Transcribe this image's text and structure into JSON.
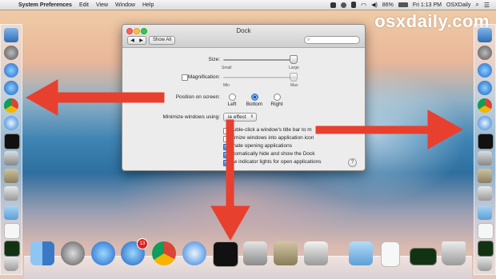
{
  "menubar": {
    "apple": "",
    "app_name": "System Preferences",
    "menus": [
      "Edit",
      "View",
      "Window",
      "Help"
    ],
    "battery": "86%",
    "clock": "Fri 1:13 PM",
    "user": "OSXDaily"
  },
  "watermark": "osxdaily.com",
  "window": {
    "title": "Dock",
    "nav_back": "◀",
    "nav_forward": "▶",
    "show_all": "Show All",
    "search_placeholder": "",
    "size_label": "Size:",
    "size_small": "Small",
    "size_large": "Large",
    "magnification_label": "Magnification:",
    "mag_min": "Min",
    "mag_max": "Max",
    "position_label": "Position on screen:",
    "position_options": [
      "Left",
      "Bottom",
      "Right"
    ],
    "position_selected": "Bottom",
    "minimize_label": "Minimize windows using:",
    "minimize_value": "ie effect",
    "options": [
      {
        "label": "ouble-click a window's title bar to m",
        "checked": false
      },
      {
        "label": "nimize windows into application icon",
        "checked": false
      },
      {
        "label": "imate opening applications",
        "checked": true
      },
      {
        "label": "utomatically hide and show the Dock",
        "checked": true
      },
      {
        "label": "ow indicator lights for open applications",
        "checked": true
      }
    ],
    "help": "?"
  },
  "dock": {
    "badge_count": "13"
  },
  "colors": {
    "arrow": "#e8402e"
  }
}
